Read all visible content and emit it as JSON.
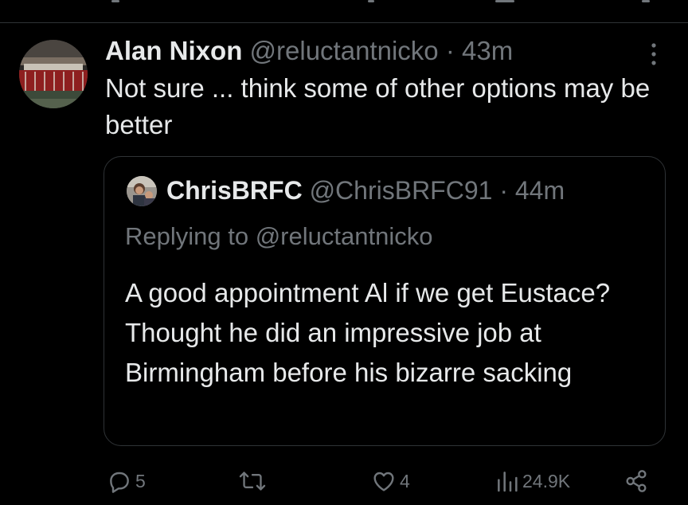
{
  "tweet": {
    "author_name": "Alan Nixon",
    "author_handle": "@reluctantnicko",
    "separator": "·",
    "time": "43m",
    "text": "Not sure ... think some of other options may be better"
  },
  "quote": {
    "author_name": "ChrisBRFC",
    "author_handle": "@ChrisBRFC91",
    "separator": "·",
    "time": "44m",
    "replying_to": "Replying to @reluctantnicko",
    "text": "A good appointment Al if we get Eustace? Thought he did an impressive job at Birmingham before his bizarre sacking"
  },
  "actions": {
    "replies": "5",
    "retweets": "",
    "likes": "4",
    "views": "24.9K"
  },
  "icons": {
    "more": "more-vertical-icon",
    "reply": "reply-icon",
    "retweet": "retweet-icon",
    "like": "heart-icon",
    "views": "views-icon",
    "share": "share-icon"
  },
  "colors": {
    "background": "#000000",
    "text_primary": "#e7e9ea",
    "text_secondary": "#71767b",
    "border": "#2f3336"
  }
}
